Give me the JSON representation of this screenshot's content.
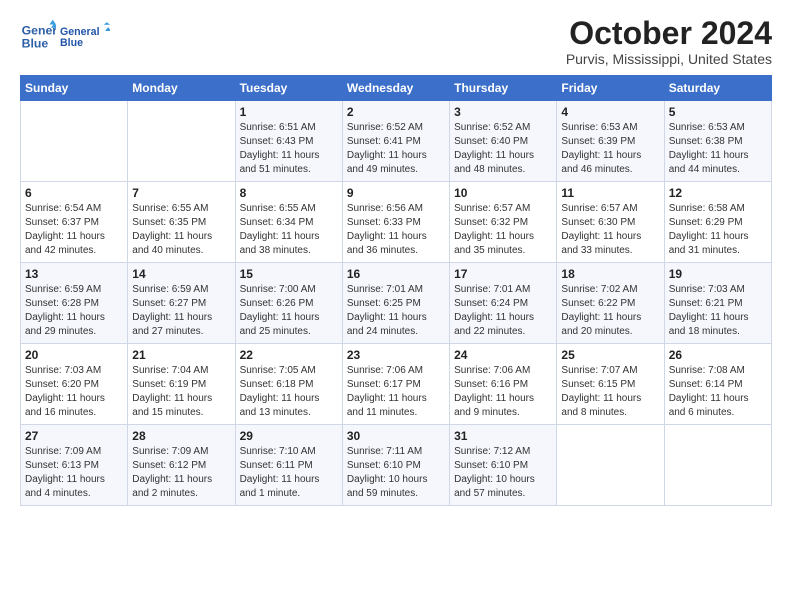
{
  "header": {
    "logo_line1": "General",
    "logo_line2": "Blue",
    "month_title": "October 2024",
    "location": "Purvis, Mississippi, United States"
  },
  "weekdays": [
    "Sunday",
    "Monday",
    "Tuesday",
    "Wednesday",
    "Thursday",
    "Friday",
    "Saturday"
  ],
  "weeks": [
    [
      {
        "day": "",
        "text": ""
      },
      {
        "day": "",
        "text": ""
      },
      {
        "day": "1",
        "text": "Sunrise: 6:51 AM\nSunset: 6:43 PM\nDaylight: 11 hours and 51 minutes."
      },
      {
        "day": "2",
        "text": "Sunrise: 6:52 AM\nSunset: 6:41 PM\nDaylight: 11 hours and 49 minutes."
      },
      {
        "day": "3",
        "text": "Sunrise: 6:52 AM\nSunset: 6:40 PM\nDaylight: 11 hours and 48 minutes."
      },
      {
        "day": "4",
        "text": "Sunrise: 6:53 AM\nSunset: 6:39 PM\nDaylight: 11 hours and 46 minutes."
      },
      {
        "day": "5",
        "text": "Sunrise: 6:53 AM\nSunset: 6:38 PM\nDaylight: 11 hours and 44 minutes."
      }
    ],
    [
      {
        "day": "6",
        "text": "Sunrise: 6:54 AM\nSunset: 6:37 PM\nDaylight: 11 hours and 42 minutes."
      },
      {
        "day": "7",
        "text": "Sunrise: 6:55 AM\nSunset: 6:35 PM\nDaylight: 11 hours and 40 minutes."
      },
      {
        "day": "8",
        "text": "Sunrise: 6:55 AM\nSunset: 6:34 PM\nDaylight: 11 hours and 38 minutes."
      },
      {
        "day": "9",
        "text": "Sunrise: 6:56 AM\nSunset: 6:33 PM\nDaylight: 11 hours and 36 minutes."
      },
      {
        "day": "10",
        "text": "Sunrise: 6:57 AM\nSunset: 6:32 PM\nDaylight: 11 hours and 35 minutes."
      },
      {
        "day": "11",
        "text": "Sunrise: 6:57 AM\nSunset: 6:30 PM\nDaylight: 11 hours and 33 minutes."
      },
      {
        "day": "12",
        "text": "Sunrise: 6:58 AM\nSunset: 6:29 PM\nDaylight: 11 hours and 31 minutes."
      }
    ],
    [
      {
        "day": "13",
        "text": "Sunrise: 6:59 AM\nSunset: 6:28 PM\nDaylight: 11 hours and 29 minutes."
      },
      {
        "day": "14",
        "text": "Sunrise: 6:59 AM\nSunset: 6:27 PM\nDaylight: 11 hours and 27 minutes."
      },
      {
        "day": "15",
        "text": "Sunrise: 7:00 AM\nSunset: 6:26 PM\nDaylight: 11 hours and 25 minutes."
      },
      {
        "day": "16",
        "text": "Sunrise: 7:01 AM\nSunset: 6:25 PM\nDaylight: 11 hours and 24 minutes."
      },
      {
        "day": "17",
        "text": "Sunrise: 7:01 AM\nSunset: 6:24 PM\nDaylight: 11 hours and 22 minutes."
      },
      {
        "day": "18",
        "text": "Sunrise: 7:02 AM\nSunset: 6:22 PM\nDaylight: 11 hours and 20 minutes."
      },
      {
        "day": "19",
        "text": "Sunrise: 7:03 AM\nSunset: 6:21 PM\nDaylight: 11 hours and 18 minutes."
      }
    ],
    [
      {
        "day": "20",
        "text": "Sunrise: 7:03 AM\nSunset: 6:20 PM\nDaylight: 11 hours and 16 minutes."
      },
      {
        "day": "21",
        "text": "Sunrise: 7:04 AM\nSunset: 6:19 PM\nDaylight: 11 hours and 15 minutes."
      },
      {
        "day": "22",
        "text": "Sunrise: 7:05 AM\nSunset: 6:18 PM\nDaylight: 11 hours and 13 minutes."
      },
      {
        "day": "23",
        "text": "Sunrise: 7:06 AM\nSunset: 6:17 PM\nDaylight: 11 hours and 11 minutes."
      },
      {
        "day": "24",
        "text": "Sunrise: 7:06 AM\nSunset: 6:16 PM\nDaylight: 11 hours and 9 minutes."
      },
      {
        "day": "25",
        "text": "Sunrise: 7:07 AM\nSunset: 6:15 PM\nDaylight: 11 hours and 8 minutes."
      },
      {
        "day": "26",
        "text": "Sunrise: 7:08 AM\nSunset: 6:14 PM\nDaylight: 11 hours and 6 minutes."
      }
    ],
    [
      {
        "day": "27",
        "text": "Sunrise: 7:09 AM\nSunset: 6:13 PM\nDaylight: 11 hours and 4 minutes."
      },
      {
        "day": "28",
        "text": "Sunrise: 7:09 AM\nSunset: 6:12 PM\nDaylight: 11 hours and 2 minutes."
      },
      {
        "day": "29",
        "text": "Sunrise: 7:10 AM\nSunset: 6:11 PM\nDaylight: 11 hours and 1 minute."
      },
      {
        "day": "30",
        "text": "Sunrise: 7:11 AM\nSunset: 6:10 PM\nDaylight: 10 hours and 59 minutes."
      },
      {
        "day": "31",
        "text": "Sunrise: 7:12 AM\nSunset: 6:10 PM\nDaylight: 10 hours and 57 minutes."
      },
      {
        "day": "",
        "text": ""
      },
      {
        "day": "",
        "text": ""
      }
    ]
  ]
}
